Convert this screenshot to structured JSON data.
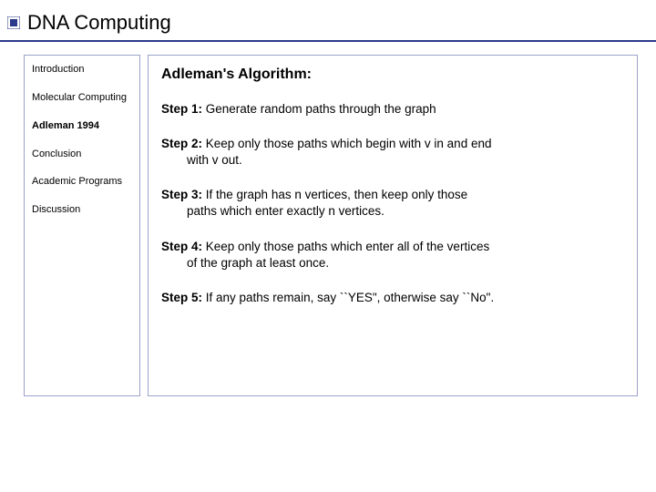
{
  "title": "DNA Computing",
  "sidebar": {
    "items": [
      {
        "label": "Introduction",
        "active": false
      },
      {
        "label": "Molecular Computing",
        "active": false
      },
      {
        "label": "Adleman 1994",
        "active": true
      },
      {
        "label": "Conclusion",
        "active": false
      },
      {
        "label": "Academic Programs",
        "active": false
      },
      {
        "label": "Discussion",
        "active": false
      }
    ]
  },
  "content": {
    "heading": "Adleman's Algorithm:",
    "steps": [
      {
        "label": "Step 1:",
        "text": " Generate random paths through the graph",
        "cont": ""
      },
      {
        "label": "Step 2:",
        "text": " Keep only those paths which begin with v in and end",
        "cont": "with v out."
      },
      {
        "label": "Step 3:",
        "text": " If the graph has n vertices, then keep only those",
        "cont": "paths which enter exactly n vertices."
      },
      {
        "label": "Step 4:",
        "text": " Keep only those paths which enter all of the vertices",
        "cont": "of the graph at least once."
      },
      {
        "label": "Step 5:",
        "text": " If any paths remain, say ``YES\", otherwise say ``No\".",
        "cont": ""
      }
    ]
  }
}
